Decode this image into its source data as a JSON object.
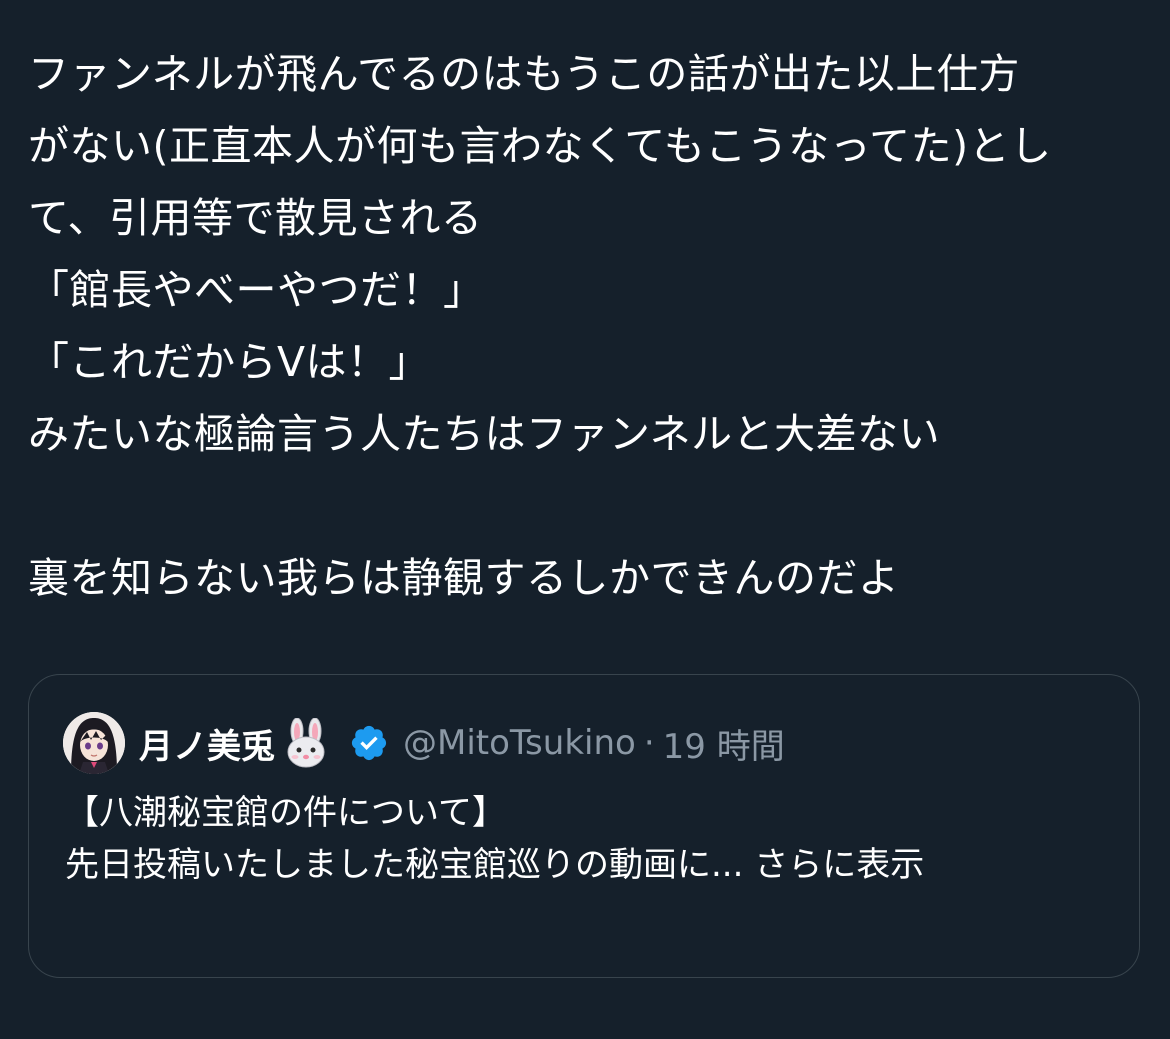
{
  "tweet": {
    "lines": [
      "ファンネルが飛んでるのはもうこの話が出た以上仕方",
      "がない(正直本人が何も言わなくてもこうなってた)とし",
      "て、引用等で散見される",
      "「館長やべーやつだ！」",
      "「これだからVは！」",
      "みたいな極論言う人たちはファンネルと大差ない",
      "",
      "裏を知らない我らは静観するしかできんのだよ"
    ]
  },
  "quote": {
    "display_name": "月ノ美兎",
    "name_emoji": "rabbit-face-icon",
    "verified": "verified-badge-icon",
    "handle": "@MitoTsukino",
    "separator": "·",
    "time": "19 時間",
    "text_line1": "【八潮秘宝館の件について】",
    "text_line2": "先日投稿いたしました秘宝館巡りの動画に...",
    "show_more": "さらに表示"
  },
  "colors": {
    "background": "#15202b",
    "text": "#ffffff",
    "muted": "#8b98a5",
    "border": "#38444d",
    "verified": "#1d9bf0"
  }
}
